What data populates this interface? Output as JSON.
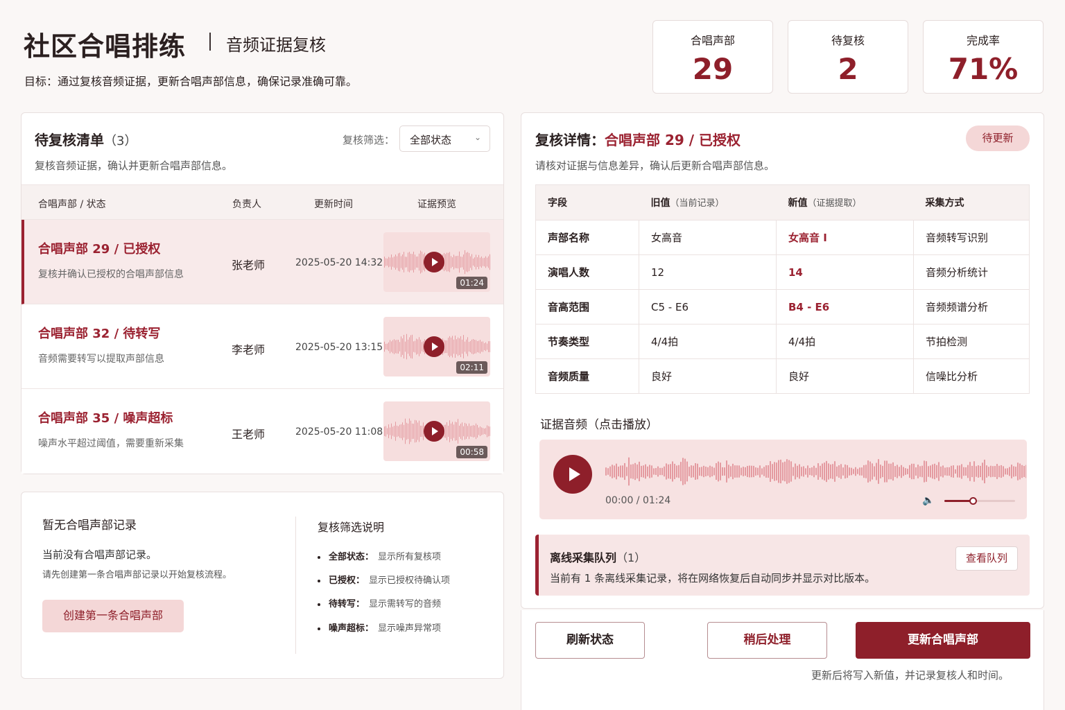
{
  "header": {
    "title": "社区合唱排练",
    "subtitle": "音频证据复核",
    "goal": "目标：通过复核音频证据，更新合唱声部信息，确保记录准确可靠。"
  },
  "stats": [
    {
      "label": "合唱声部",
      "value": "29"
    },
    {
      "label": "待复核",
      "value": "2"
    },
    {
      "label": "完成率",
      "value": "71%"
    }
  ],
  "queue_panel": {
    "title": "待复核清单",
    "count": "（3）",
    "desc": "复核音频证据，确认并更新合唱声部信息。",
    "filter_label": "复核筛选：",
    "filter_value": "全部状态",
    "columns": [
      "合唱声部 / 状态",
      "负责人",
      "更新时间",
      "证据预览"
    ],
    "rows": [
      {
        "name": "合唱声部 29 / 已授权",
        "desc": "复核并确认已授权的合唱声部信息",
        "owner": "张老师",
        "time": "2025-05-20 14:32",
        "duration": "01:24"
      },
      {
        "name": "合唱声部 32 / 待转写",
        "desc": "音频需要转写以提取声部信息",
        "owner": "李老师",
        "time": "2025-05-20 13:15",
        "duration": "02:11"
      },
      {
        "name": "合唱声部 35 / 噪声超标",
        "desc": "噪声水平超过阈值，需要重新采集",
        "owner": "王老师",
        "time": "2025-05-20 11:08",
        "duration": "00:58"
      }
    ]
  },
  "empty_panel": {
    "title": "暂无合唱声部记录",
    "line1": "当前没有合唱声部记录。",
    "line2": "请先创建第一条合唱声部记录以开始复核流程。",
    "create_label": "创建第一条合唱声部"
  },
  "help": {
    "title": "复核筛选说明",
    "items": [
      {
        "key": "全部状态：",
        "val": "显示所有复核项"
      },
      {
        "key": "已授权：",
        "val": "显示已授权待确认项"
      },
      {
        "key": "待转写：",
        "val": "显示需转写的音频"
      },
      {
        "key": "噪声超标：",
        "val": "显示噪声异常项"
      }
    ]
  },
  "detail": {
    "title_prefix": "复核详情：",
    "title_target": "合唱声部 29 / 已授权",
    "badge": "待更新",
    "desc": "请核对证据与信息差异，确认后更新合唱声部信息。",
    "columns": {
      "field": "字段",
      "old": "旧值",
      "old_note": "（当前记录）",
      "new": "新值",
      "new_note": "（证据提取）",
      "method": "采集方式"
    },
    "rows": [
      {
        "field": "声部名称",
        "old": "女高音",
        "new": "女高音 I",
        "new_changed": true,
        "method": "音频转写识别"
      },
      {
        "field": "演唱人数",
        "old": "12",
        "new": "14",
        "new_changed": true,
        "method": "音频分析统计"
      },
      {
        "field": "音高范围",
        "old": "C5 - E6",
        "new": "B4 - E6",
        "new_changed": true,
        "method": "音频频谱分析"
      },
      {
        "field": "节奏类型",
        "old": "4/4拍",
        "new": "4/4拍",
        "new_changed": false,
        "method": "节拍检测"
      },
      {
        "field": "音频质量",
        "old": "良好",
        "new": "良好",
        "new_changed": false,
        "method": "信噪比分析"
      }
    ],
    "evidence_title": "证据音频（点击播放）",
    "player_time": "00:00 / 01:24",
    "volume_level": 0.4
  },
  "offline": {
    "title": "离线采集队列",
    "count": "（1）",
    "desc": "当前有 1 条离线采集记录，将在网络恢复后自动同步并显示对比版本。",
    "view_label": "查看队列"
  },
  "actions": {
    "refresh": "刷新状态",
    "later": "稍后处理",
    "update": "更新合唱声部",
    "footnote": "更新后将写入新值，并记录复核人和时间。"
  },
  "colors": {
    "accent": "#8e1f2a",
    "accent_light": "#f4d7d7",
    "waveform": "#e49aa0"
  }
}
